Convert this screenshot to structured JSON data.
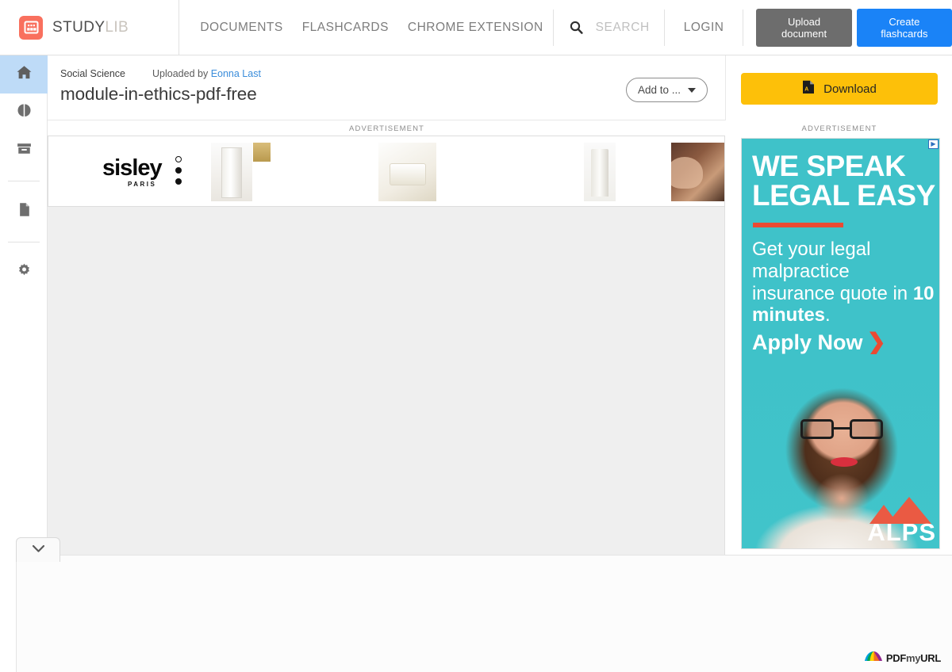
{
  "topnav": {
    "brand_primary": "STUDY",
    "brand_secondary": "LIB",
    "logo_icon": "studylib-grid-icon",
    "links": [
      {
        "label": "DOCUMENTS",
        "name": "nav-documents"
      },
      {
        "label": "FLASHCARDS",
        "name": "nav-flashcards"
      },
      {
        "label": "CHROME EXTENSION",
        "name": "nav-chrome-extension"
      }
    ],
    "search": {
      "icon": "search-icon",
      "placeholder": "SEARCH",
      "value": ""
    },
    "login_label": "LOGIN",
    "upload_label": "Upload document",
    "create_label": "Create flashcards",
    "upload_color": "#6d6d6d",
    "create_color": "#1a83f7"
  },
  "sidebar": {
    "items": [
      {
        "name": "sidebar-item-home",
        "icon": "home-icon",
        "active": true
      },
      {
        "name": "sidebar-item-flashcards",
        "icon": "brain-icon",
        "active": false
      },
      {
        "name": "sidebar-item-archive",
        "icon": "archive-box-icon",
        "active": false
      },
      {
        "name": "sidebar-item-documents",
        "icon": "document-page-icon",
        "active": false
      },
      {
        "name": "sidebar-item-settings",
        "icon": "gear-icon",
        "active": false
      }
    ],
    "active_color": "#bedbf7"
  },
  "document": {
    "category": "Social Science",
    "uploaded_prefix": "Uploaded by",
    "uploader": "Eonna Last",
    "uploader_color": "#3a8ddb",
    "title": "module-in-ethics-pdf-free",
    "add_to_label": "Add to ...",
    "add_to_icon": "chevron-down-icon"
  },
  "ads": {
    "label": "ADVERTISEMENT",
    "banner": {
      "brand": "sisley",
      "brand_sub": "PARIS",
      "menu_icon": "three-dots-icon"
    },
    "sidebar_ad": {
      "headline_line1": "WE SPEAK",
      "headline_line2": "LEGAL EASY",
      "body_part1": "Get your legal malpractice insurance quote in ",
      "body_bold": "10 minutes",
      "body_part2": ".",
      "cta": "Apply Now",
      "cta_icon": "chevron-right-icon",
      "advertiser": "ALPS",
      "adchoices_icon": "adchoices-icon",
      "bg_color": "#3fc2c9",
      "accent_color": "#ea4a33"
    }
  },
  "download": {
    "label": "Download",
    "icon": "pdf-file-icon",
    "color": "#fdc009"
  },
  "viewer": {
    "collapse_icon": "chevron-down-icon",
    "background_color": "#efefef"
  },
  "footer": {
    "watermark_pre": "PDF",
    "watermark_mid": "my",
    "watermark_post": "URL",
    "watermark_icon": "pdfmyurl-fan-icon"
  }
}
